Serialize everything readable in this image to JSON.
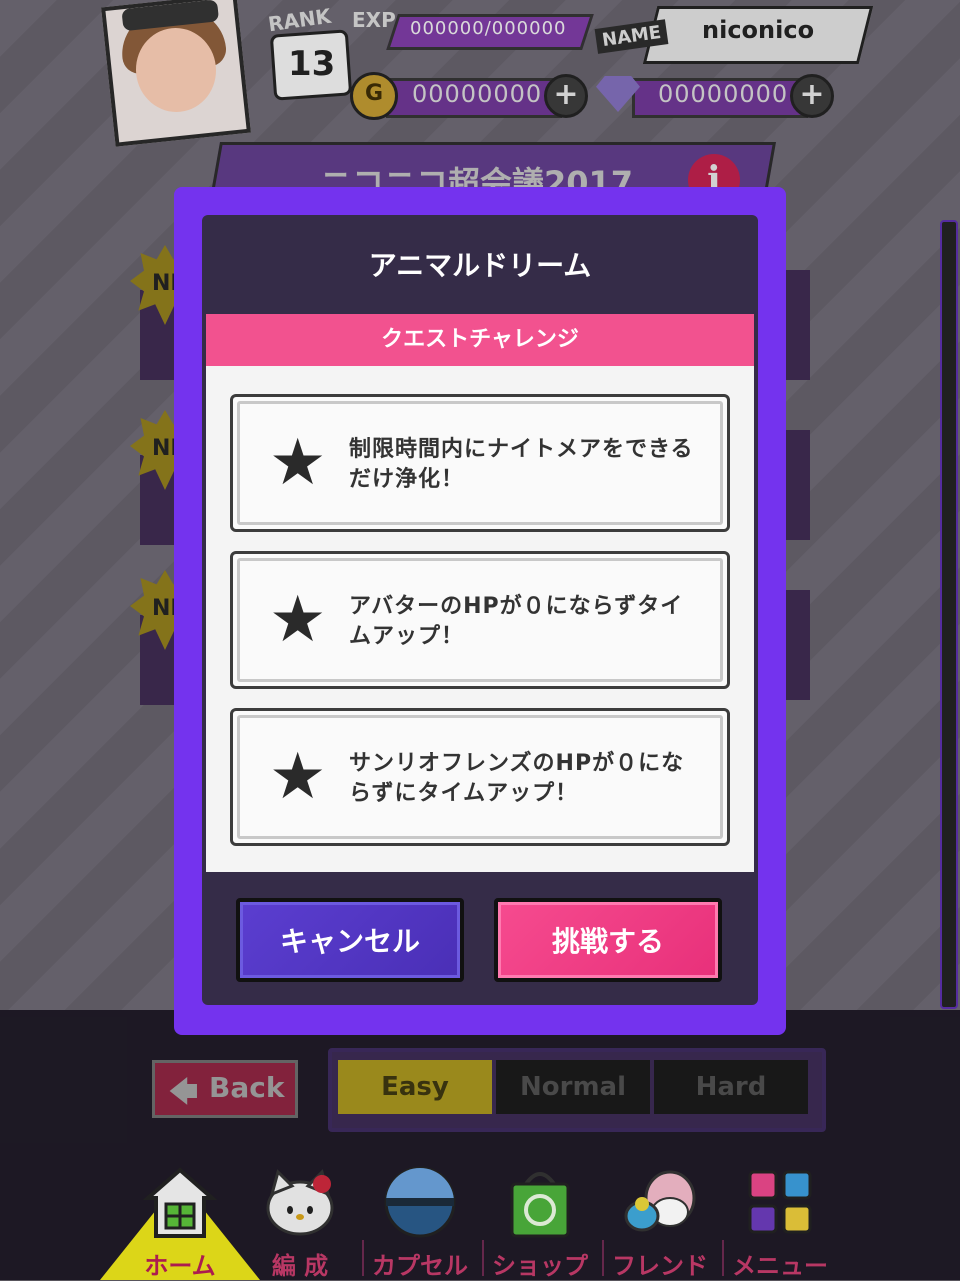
{
  "header": {
    "rank_label": "RANK",
    "rank_value": "13",
    "exp_label": "EXP",
    "exp_value": "000000/000000",
    "name_label": "NAME",
    "name_value": "niconico",
    "coin_symbol": "G",
    "coins": "00000000",
    "gems": "00000000",
    "plus": "+"
  },
  "event": {
    "title": "ニコニコ超会議2017",
    "info": "i"
  },
  "badges": {
    "new": "NEW"
  },
  "dialog": {
    "title": "アニマルドリーム",
    "subtitle": "クエストチャレンジ",
    "challenges": [
      {
        "star": "★",
        "text": "制限時間内にナイトメアをできるだけ浄化！"
      },
      {
        "star": "★",
        "text": "アバターのHPが０にならずタイムアップ！"
      },
      {
        "star": "★",
        "text": "サンリオフレンズのHPが０にならずにタイムアップ！"
      }
    ],
    "cancel_label": "キャンセル",
    "confirm_label": "挑戦する"
  },
  "bottom": {
    "back_arrow": "🡄",
    "back_label": "Back",
    "difficulty": [
      "Easy",
      "Normal",
      "Hard"
    ],
    "selected_difficulty": "Easy"
  },
  "nav": {
    "items": [
      {
        "label": "ホーム",
        "icon": "house-icon"
      },
      {
        "label": "編 成",
        "icon": "kitty-icon"
      },
      {
        "label": "カプセル",
        "icon": "capsule-icon"
      },
      {
        "label": "ショップ",
        "icon": "shopping-bag-icon"
      },
      {
        "label": "フレンド",
        "icon": "friends-icon"
      },
      {
        "label": "メニュー",
        "icon": "grid-menu-icon"
      }
    ]
  },
  "colors": {
    "modal_frame": "#7433ee",
    "modal_body": "#352c48",
    "subhead_pink": "#f2528f",
    "cancel_purple": "#4a2fb6",
    "confirm_pink": "#e8307a",
    "easy_yellow": "#a3911e"
  }
}
